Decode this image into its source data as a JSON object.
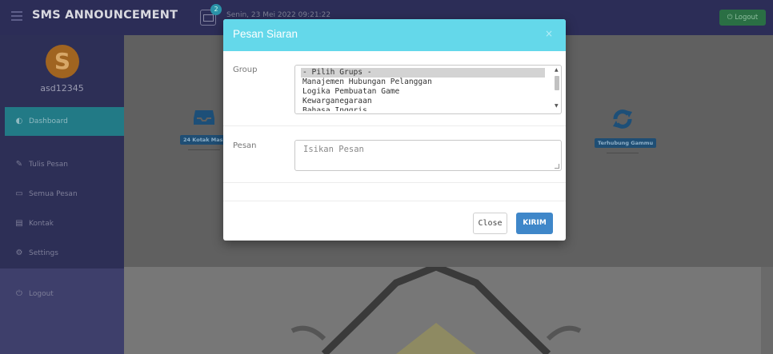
{
  "header": {
    "brand": "SMS ANNOUNCEMENT",
    "badge_count": "2",
    "datetime": "Senin, 23 Mei 2022 09:21:22",
    "logout_label": "Logout"
  },
  "sidebar": {
    "avatar_letter": "S",
    "username": "asd12345",
    "items": [
      {
        "label": "Dashboard",
        "icon": "dashboard-icon"
      },
      {
        "label": "Tulis Pesan",
        "icon": "edit-icon"
      },
      {
        "label": "Semua Pesan",
        "icon": "folder-icon"
      },
      {
        "label": "Kontak",
        "icon": "book-icon"
      },
      {
        "label": "Settings",
        "icon": "gears-icon"
      },
      {
        "label": "Logout",
        "icon": "power-icon"
      }
    ]
  },
  "dashboard": {
    "inbox_label": "24 Kotak Masu",
    "gammu_label": "Terhubung Gammu"
  },
  "modal": {
    "title": "Pesan Siaran",
    "close_x": "×",
    "group_label": "Group",
    "group_options": [
      "- Pilih Grups -",
      "Manajemen Hubungan Pelanggan",
      "Logika Pembuatan Game",
      "Kewarganegaraan",
      "Bahasa Inggris"
    ],
    "pesan_label": "Pesan",
    "pesan_placeholder": "Isikan Pesan",
    "close_button": "Close",
    "send_button": "KIRIM"
  },
  "colors": {
    "header_bg": "#2c2d57",
    "sidebar_bg": "#2d2f56",
    "active_item": "#227a86",
    "modal_header": "#64d8ea",
    "kirim_button": "#3f87c9"
  }
}
